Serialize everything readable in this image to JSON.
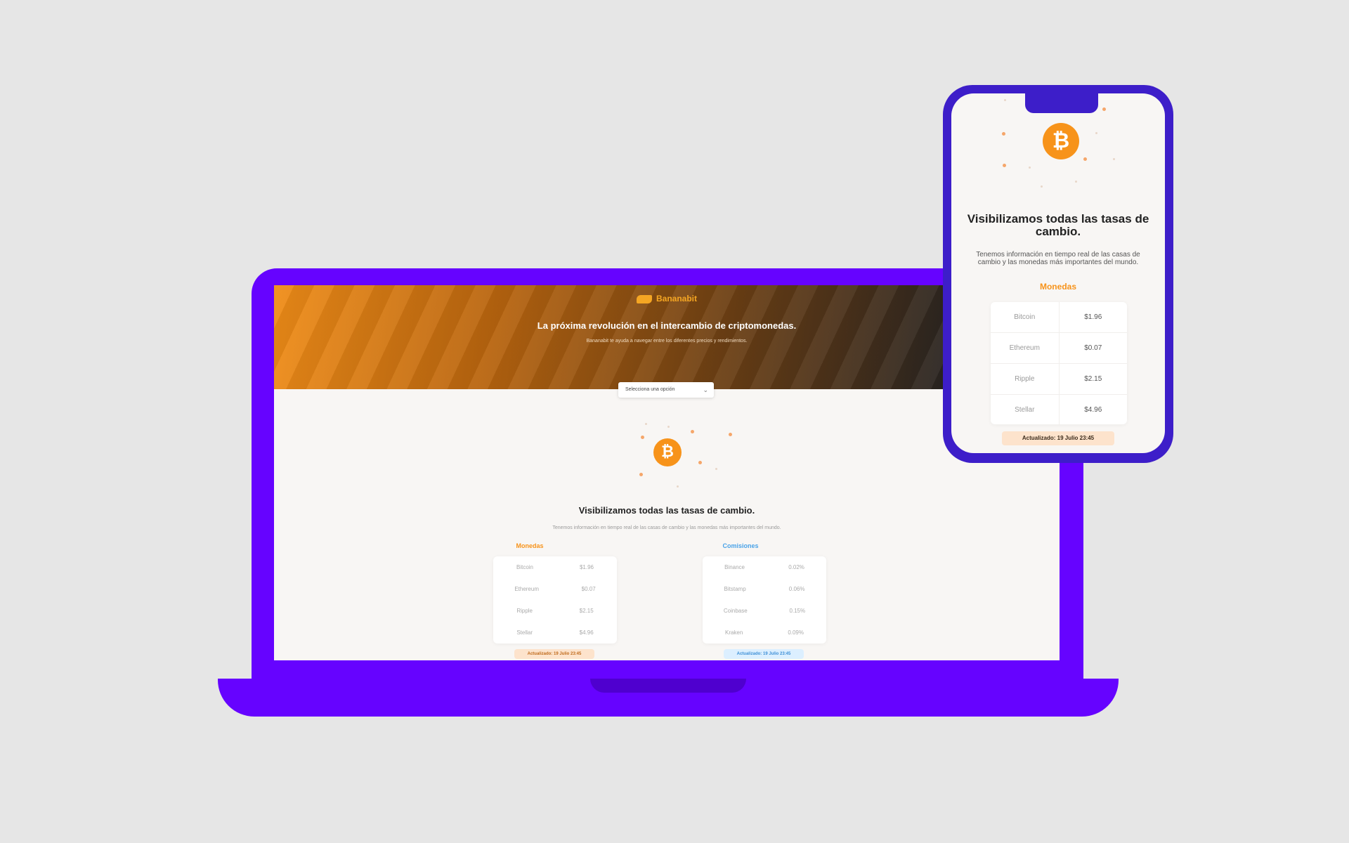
{
  "laptop": {
    "brand": "Bananabit",
    "hero_title": "La próxima revolución en el intercambio de criptomonedas.",
    "hero_sub": "Bananabit te ayuda a navegar entre los diferentes precios y rendimientos.",
    "select_value": "Selecciona una opción",
    "coin_symbol": "₿",
    "section_title": "Visibilizamos todas las tasas de cambio.",
    "section_sub": "Tenemos información en tiempo real de las casas de cambio y las monedas más importantes del mundo.",
    "coins": {
      "title": "Monedas",
      "rows": [
        {
          "name": "Bitcoin",
          "value": "$1.96"
        },
        {
          "name": "Ethereum",
          "value": "$0.07"
        },
        {
          "name": "Ripple",
          "value": "$2.15"
        },
        {
          "name": "Stellar",
          "value": "$4.96"
        }
      ],
      "badge": "Actualizado: 19 Julio 23:45"
    },
    "exchanges": {
      "title": "Comisiones",
      "rows": [
        {
          "name": "Binance",
          "value": "0.02%"
        },
        {
          "name": "Bitstamp",
          "value": "0.06%"
        },
        {
          "name": "Coinbase",
          "value": "0.15%"
        },
        {
          "name": "Kraken",
          "value": "0.09%"
        }
      ],
      "badge": "Actualizado: 19 Julio 23:45"
    }
  },
  "phone": {
    "coin_symbol": "₿",
    "title": "Visibilizamos todas las tasas de cambio.",
    "subtitle": "Tenemos información en tiempo real de las casas de cambio y las monedas más importantes del mundo.",
    "section": "Monedas",
    "rows": [
      {
        "name": "Bitcoin",
        "value": "$1.96"
      },
      {
        "name": "Ethereum",
        "value": "$0.07"
      },
      {
        "name": "Ripple",
        "value": "$2.15"
      },
      {
        "name": "Stellar",
        "value": "$4.96"
      }
    ],
    "badge": "Actualizado: 19 Julio 23:45"
  },
  "colors": {
    "background": "#e6e6e6",
    "laptop_frame": "#6603ff",
    "phone_frame": "#3d1ec9",
    "accent_orange": "#f7931a",
    "accent_blue": "#4aa3e8"
  },
  "icons": {
    "coin": "bitcoin-icon",
    "brand": "banana-logo-icon",
    "select": "chevron-down-icon"
  }
}
